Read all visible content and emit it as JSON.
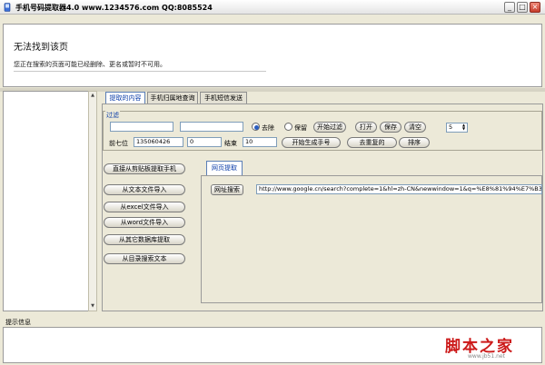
{
  "window": {
    "title": "手机号码提取器4.0  www.1234576.com QQ:8085524",
    "buttons": [
      "_",
      "□",
      "×"
    ]
  },
  "browser": {
    "error_title": "无法找到该页",
    "error_text": "您正在搜索的页面可能已经删除、更名或暂时不可用。"
  },
  "tabs": [
    "提取的内容",
    "手机归属地查询",
    "手机短信发送"
  ],
  "filter": {
    "group_label": "过滤",
    "radio_remove": "去除",
    "radio_keep": "保留",
    "start_filter": "开始过滤",
    "open": "打开",
    "save": "保存",
    "clear": "清空",
    "spin_value": "5",
    "prefix_label": "前七位",
    "prefix_value": "135060426",
    "start_label": "起始",
    "start_value": "0",
    "end_label": "结束",
    "end_value": "10",
    "generate": "开始生成手号",
    "dedupe": "去重复的",
    "sort": "排序"
  },
  "side_buttons": [
    "直接从剪贴板提取手机",
    "从文本文件导入",
    "从excel文件导入",
    "从word文件导入",
    "从其它数据库提取",
    "从目录搜索文本"
  ],
  "web": {
    "tab_label": "网页提取",
    "go_button": "网址搜索",
    "url": "http://www.google.cn/search?complete=1&hl=zh-CN&newwindow=1&q=%E8%81%94%E7%B3%BB%E6%89%8B%E6%9C%BA"
  },
  "status": {
    "label": "提示信息"
  },
  "watermark": {
    "main": "脚本之家",
    "sub": "www.jb51.net"
  },
  "colors": {
    "accent": "#0a3ca8",
    "background": "#ece9d8"
  }
}
